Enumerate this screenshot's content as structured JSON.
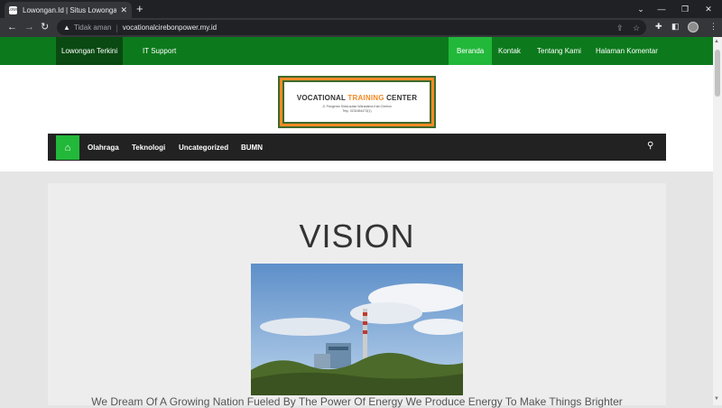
{
  "browser": {
    "tab_title": "Lowongan.Id | Situs Lowongan C",
    "favicon_text": "Lowo",
    "new_tab": "+",
    "security_label": "Tidak aman",
    "url": "vocationalcirebonpower.my.id"
  },
  "topnav": {
    "left": [
      "Lowongan Terkini",
      "IT Support"
    ],
    "right": [
      "Beranda",
      "Kontak",
      "Tentang Kami",
      "Halaman Komentar"
    ]
  },
  "logo": {
    "title_part1": "VOCATIONAL ",
    "title_part2": "TRAINING",
    "title_part3": " CENTER",
    "address": "Jl. Pangeran SidaLautan Waradama Kab.Cirebon",
    "phone": "Telp. 0231654473(1)"
  },
  "mainnav": {
    "items": [
      "Olahraga",
      "Teknologi",
      "Uncategorized",
      "BUMN"
    ]
  },
  "content": {
    "heading": "VISION",
    "caption": "We Dream Of A Growing Nation Fueled By The Power Of Energy We Produce Energy To Make Things Brighter"
  },
  "colors": {
    "topnav_bg": "#0c7a1c",
    "active_bg": "#22b83a",
    "mainnav_bg": "#222222",
    "logo_accent": "#f28a26"
  }
}
